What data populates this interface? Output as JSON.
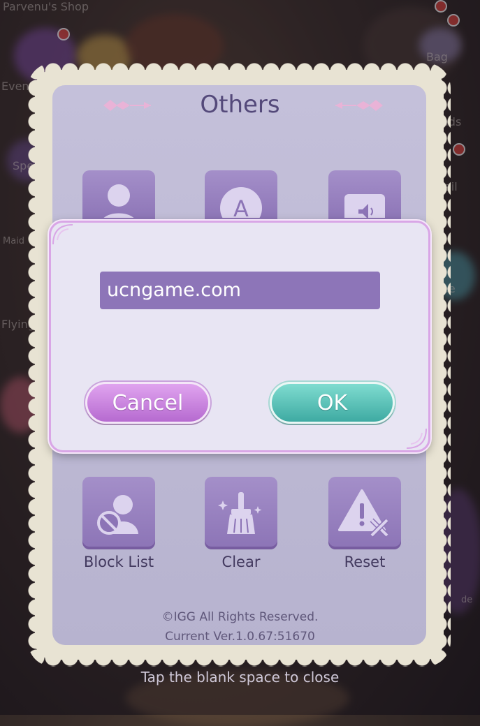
{
  "background": {
    "labels": {
      "shop": "Parvenu's Shop",
      "event": "Event",
      "bag": "Bag",
      "spe": "Spe",
      "maid": "Maid",
      "flying": "Flying",
      "ads": "ads",
      "ail": "ail",
      "ee": "ee",
      "de": "de"
    }
  },
  "panel": {
    "title": "Others",
    "tiles": [
      {
        "label": "Block List",
        "icon": "block-user-icon"
      },
      {
        "label": "Clear",
        "icon": "broom-icon"
      },
      {
        "label": "Reset",
        "icon": "warning-tools-icon"
      }
    ],
    "top_tiles": [
      {
        "icon": "profile-icon"
      },
      {
        "icon": "font-icon"
      },
      {
        "icon": "speaker-icon"
      }
    ],
    "copyright": "©IGG All Rights Reserved.",
    "version": "Current Ver.1.0.67:51670"
  },
  "dialog": {
    "input_value": "ucngame.com",
    "cancel_label": "Cancel",
    "ok_label": "OK"
  },
  "close_hint": "Tap the blank space to close",
  "colors": {
    "panel": "#b7b3cf",
    "tile": "#8c74b6",
    "input": "#8d75b8",
    "cancel": "#b66ad0",
    "ok": "#3eaaa2",
    "title": "#54497a"
  }
}
